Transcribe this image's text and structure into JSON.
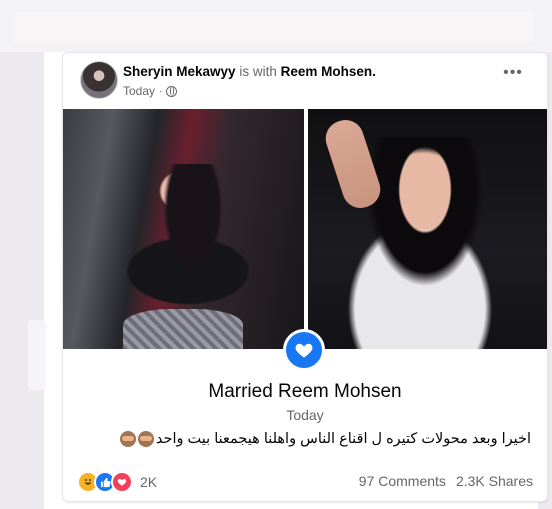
{
  "post": {
    "author": "Sheryin Mekawyy",
    "with_text": "is with",
    "tagged": "Reem Mohsen.",
    "time": "Today",
    "time_sep": "·",
    "privacy_icon": "globe-icon",
    "more_icon": "ellipsis-icon",
    "more_label": "•••"
  },
  "event": {
    "icon": "heart-event-icon",
    "title": "Married Reem Mohsen",
    "date": "Today"
  },
  "caption": "اخيرا وبعد محولات كتيره ل اقناع الناس واهلنا هيجمعنا بيت واحد",
  "footer": {
    "reaction_icons": [
      "haha-icon",
      "like-icon",
      "love-icon"
    ],
    "reaction_count": "2K",
    "comments": "97 Comments",
    "shares": "2.3K Shares"
  },
  "colors": {
    "accent": "#1877f2",
    "muted_text": "#65676b",
    "haha": "#f7b125",
    "love": "#f33e58"
  }
}
